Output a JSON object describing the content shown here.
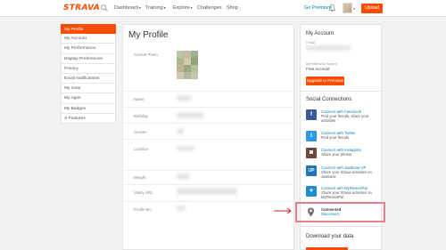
{
  "brand": {
    "logo": "STRAVA",
    "accent": "#fc4c02",
    "link": "#007fb6"
  },
  "nav": {
    "items": [
      {
        "label": "Dashboard",
        "has_caret": true
      },
      {
        "label": "Training",
        "has_caret": true
      },
      {
        "label": "Explore",
        "has_caret": true
      },
      {
        "label": "Challenges",
        "has_caret": false
      },
      {
        "label": "Shop",
        "has_caret": false
      }
    ],
    "go_premium": "Go Premium",
    "upload": "Upload",
    "icons": {
      "search": "search-icon",
      "notifications": "bell-icon"
    }
  },
  "sidebar": {
    "items": [
      {
        "label": "My Profile",
        "active": true
      },
      {
        "label": "My Account",
        "active": false
      },
      {
        "label": "My Performance",
        "active": false
      },
      {
        "label": "Display Preferences",
        "active": false
      },
      {
        "label": "Privacy",
        "active": false
      },
      {
        "label": "Email Notifications",
        "active": false
      },
      {
        "label": "My Gear",
        "active": false
      },
      {
        "label": "My Apps",
        "active": false
      },
      {
        "label": "My Badges",
        "active": false
      },
      {
        "label": "X-Features",
        "active": false
      }
    ]
  },
  "profile": {
    "title": "My Profile",
    "fields": {
      "photo": "Current Photo",
      "name": "Name",
      "birthday": "Birthday",
      "gender": "Gender",
      "location": "Location",
      "weight": "Weight",
      "vanity_url": "Vanity URL",
      "bio": "Profile Bio"
    }
  },
  "account": {
    "title": "My Account",
    "email_label": "Email",
    "membership_label": "Membership Status",
    "membership_value": "Free Account",
    "upgrade": "Upgrade to Premium"
  },
  "social": {
    "title": "Social Connections",
    "items": [
      {
        "link": "Connect with Facebook",
        "desc": "Find your friends, share your activities",
        "icon": "facebook-icon",
        "glyph": "f",
        "color": "#3b5998"
      },
      {
        "link": "Connect with Twitter",
        "desc": "Find your friends",
        "icon": "twitter-icon",
        "glyph": "t",
        "color": "#2b9ae2"
      },
      {
        "link": "Connect with Instagram",
        "desc": "Share your photos",
        "icon": "instagram-icon",
        "glyph": "◙",
        "color": "#6b4b3a"
      },
      {
        "link": "Connect with Jawbone UP",
        "desc": "Share your Strava activities on Jawbone",
        "icon": "jawbone-icon",
        "glyph": "UP",
        "color": "#1f73b7"
      },
      {
        "link": "Connect with MyFitnessPal",
        "desc": "Share your Strava activities on MyFitnessPal",
        "icon": "myfitnesspal-icon",
        "glyph": "✦",
        "color": "#1d8fd0"
      }
    ],
    "connected": {
      "status": "Connected",
      "action": "Disconnect",
      "icon": "map-pin-icon"
    }
  },
  "download": {
    "title": "Download your data"
  }
}
